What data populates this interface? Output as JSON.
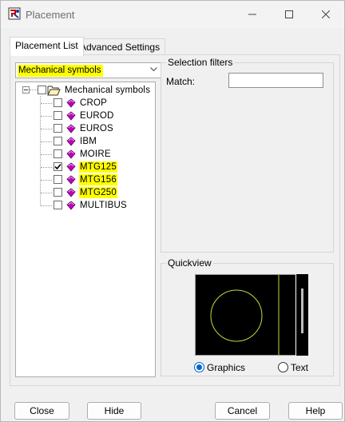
{
  "window": {
    "title": "Placement"
  },
  "tabs": [
    {
      "label": "Placement List",
      "active": true
    },
    {
      "label": "Advanced Settings",
      "active": false
    }
  ],
  "symbol_set_combo": {
    "value": "Mechanical symbols"
  },
  "tree": {
    "root": {
      "label": "Mechanical symbols",
      "checked": false,
      "expanded": true
    },
    "items": [
      {
        "label": "CROP",
        "checked": false,
        "highlighted": false
      },
      {
        "label": "EUROD",
        "checked": false,
        "highlighted": false
      },
      {
        "label": "EUROS",
        "checked": false,
        "highlighted": false
      },
      {
        "label": "IBM",
        "checked": false,
        "highlighted": false
      },
      {
        "label": "MOIRE",
        "checked": false,
        "highlighted": false
      },
      {
        "label": "MTG125",
        "checked": true,
        "highlighted": true
      },
      {
        "label": "MTG156",
        "checked": false,
        "highlighted": true
      },
      {
        "label": "MTG250",
        "checked": false,
        "highlighted": true
      },
      {
        "label": "MULTIBUS",
        "checked": false,
        "highlighted": false
      }
    ]
  },
  "selection_filters": {
    "title": "Selection filters",
    "match_label": "Match:",
    "match_value": ""
  },
  "quickview": {
    "title": "Quickview",
    "mode_options": [
      {
        "label": "Graphics",
        "selected": true
      },
      {
        "label": "Text",
        "selected": false
      }
    ]
  },
  "buttons": {
    "close": "Close",
    "hide": "Hide",
    "cancel": "Cancel",
    "help": "Help"
  },
  "colors": {
    "highlight": "#ffff00",
    "symbol_icon": "#c000c0",
    "preview_background": "#000000",
    "preview_outline": "#c8d83c",
    "radio_accent": "#0066cc"
  }
}
